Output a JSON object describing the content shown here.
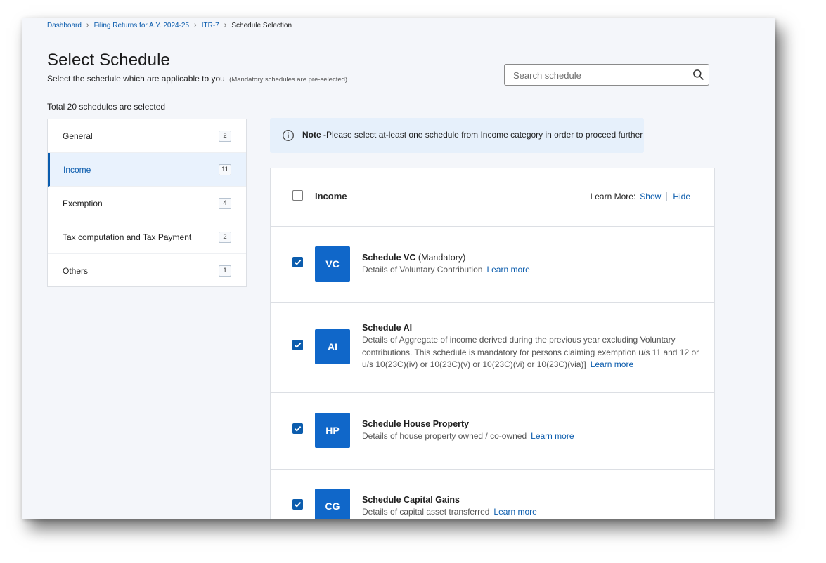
{
  "breadcrumb": {
    "items": [
      "Dashboard",
      "Filing Returns for A.Y. 2024-25",
      "ITR-7"
    ],
    "current": "Schedule Selection"
  },
  "page": {
    "title": "Select Schedule",
    "subtitle": "Select the schedule which are applicable to you",
    "subtitle_note": "(Mandatory schedules are pre-selected)",
    "total_selected": "Total 20 schedules are selected"
  },
  "search": {
    "placeholder": "Search schedule",
    "value": "",
    "icon": "search-icon"
  },
  "categories": [
    {
      "label": "General",
      "count": "2",
      "active": false
    },
    {
      "label": "Income",
      "count": "11",
      "active": true
    },
    {
      "label": "Exemption",
      "count": "4",
      "active": false
    },
    {
      "label": "Tax computation and Tax Payment",
      "count": "2",
      "active": false
    },
    {
      "label": "Others",
      "count": "1",
      "active": false
    }
  ],
  "note": {
    "icon": "info-icon",
    "label": "Note -",
    "text": "Please select at-least one schedule from Income category in order to proceed further"
  },
  "panel": {
    "title": "Income",
    "select_all_checked": false,
    "learn_more_label": "Learn More:",
    "show_label": "Show",
    "hide_label": "Hide"
  },
  "schedules": [
    {
      "code": "VC",
      "title": "Schedule VC",
      "tag": "(Mandatory)",
      "desc": "Details of Voluntary Contribution",
      "link": "Learn more",
      "checked": true
    },
    {
      "code": "AI",
      "title": "Schedule AI",
      "tag": "",
      "desc": "Details of Aggregate of income derived during the previous year excluding Voluntary contributions. This schedule is mandatory for persons claiming exemption u/s 11 and 12 or u/s 10(23C)(iv) or 10(23C)(v) or 10(23C)(vi) or 10(23C)(via)]",
      "link": "Learn more",
      "checked": true
    },
    {
      "code": "HP",
      "title": "Schedule House Property",
      "tag": "",
      "desc": "Details of house property owned / co-owned",
      "link": "Learn more",
      "checked": true
    },
    {
      "code": "CG",
      "title": "Schedule Capital Gains",
      "tag": "",
      "desc": "Details of capital asset transferred",
      "link": "Learn more",
      "checked": true
    }
  ],
  "colors": {
    "accent": "#0b5cad",
    "badge": "#1067c9",
    "note_bg": "#e6f0fb",
    "page_bg": "#f4f6fa"
  }
}
